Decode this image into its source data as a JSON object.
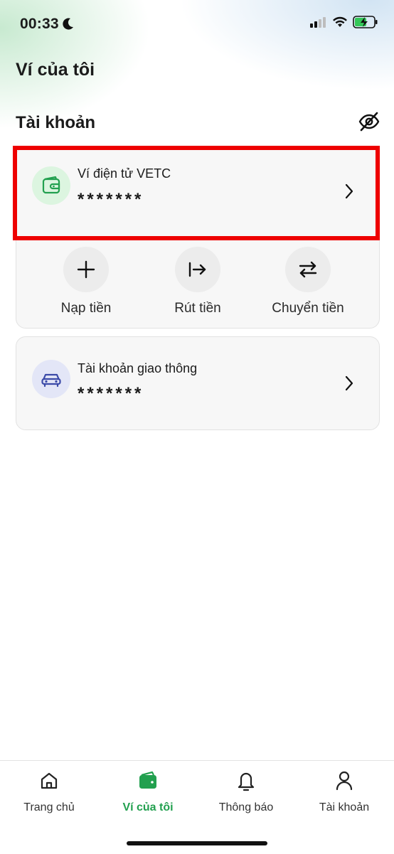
{
  "status_bar": {
    "time": "00:33"
  },
  "header": {
    "title": "Ví của tôi"
  },
  "section": {
    "title": "Tài khoản"
  },
  "wallet": {
    "name": "Ví điện tử VETC",
    "masked_balance": "*******",
    "actions": [
      {
        "label": "Nạp tiền",
        "icon": "plus-icon"
      },
      {
        "label": "Rút tiền",
        "icon": "withdraw-arrow-icon"
      },
      {
        "label": "Chuyển tiền",
        "icon": "transfer-arrows-icon"
      }
    ]
  },
  "traffic_account": {
    "name": "Tài khoản giao thông",
    "masked_balance": "*******"
  },
  "bottom_nav": {
    "items": [
      {
        "label": "Trang chủ",
        "icon": "home-icon",
        "active": false
      },
      {
        "label": "Ví của tôi",
        "icon": "wallet-icon",
        "active": true
      },
      {
        "label": "Thông báo",
        "icon": "bell-icon",
        "active": false
      },
      {
        "label": "Tài khoản",
        "icon": "user-icon",
        "active": false
      }
    ]
  },
  "colors": {
    "accent": "#22a04f",
    "highlight": "#ee0000",
    "wallet_icon_bg": "#dcf5e0",
    "car_icon_bg": "#e3e6f7",
    "car_icon": "#3b4aa8"
  }
}
